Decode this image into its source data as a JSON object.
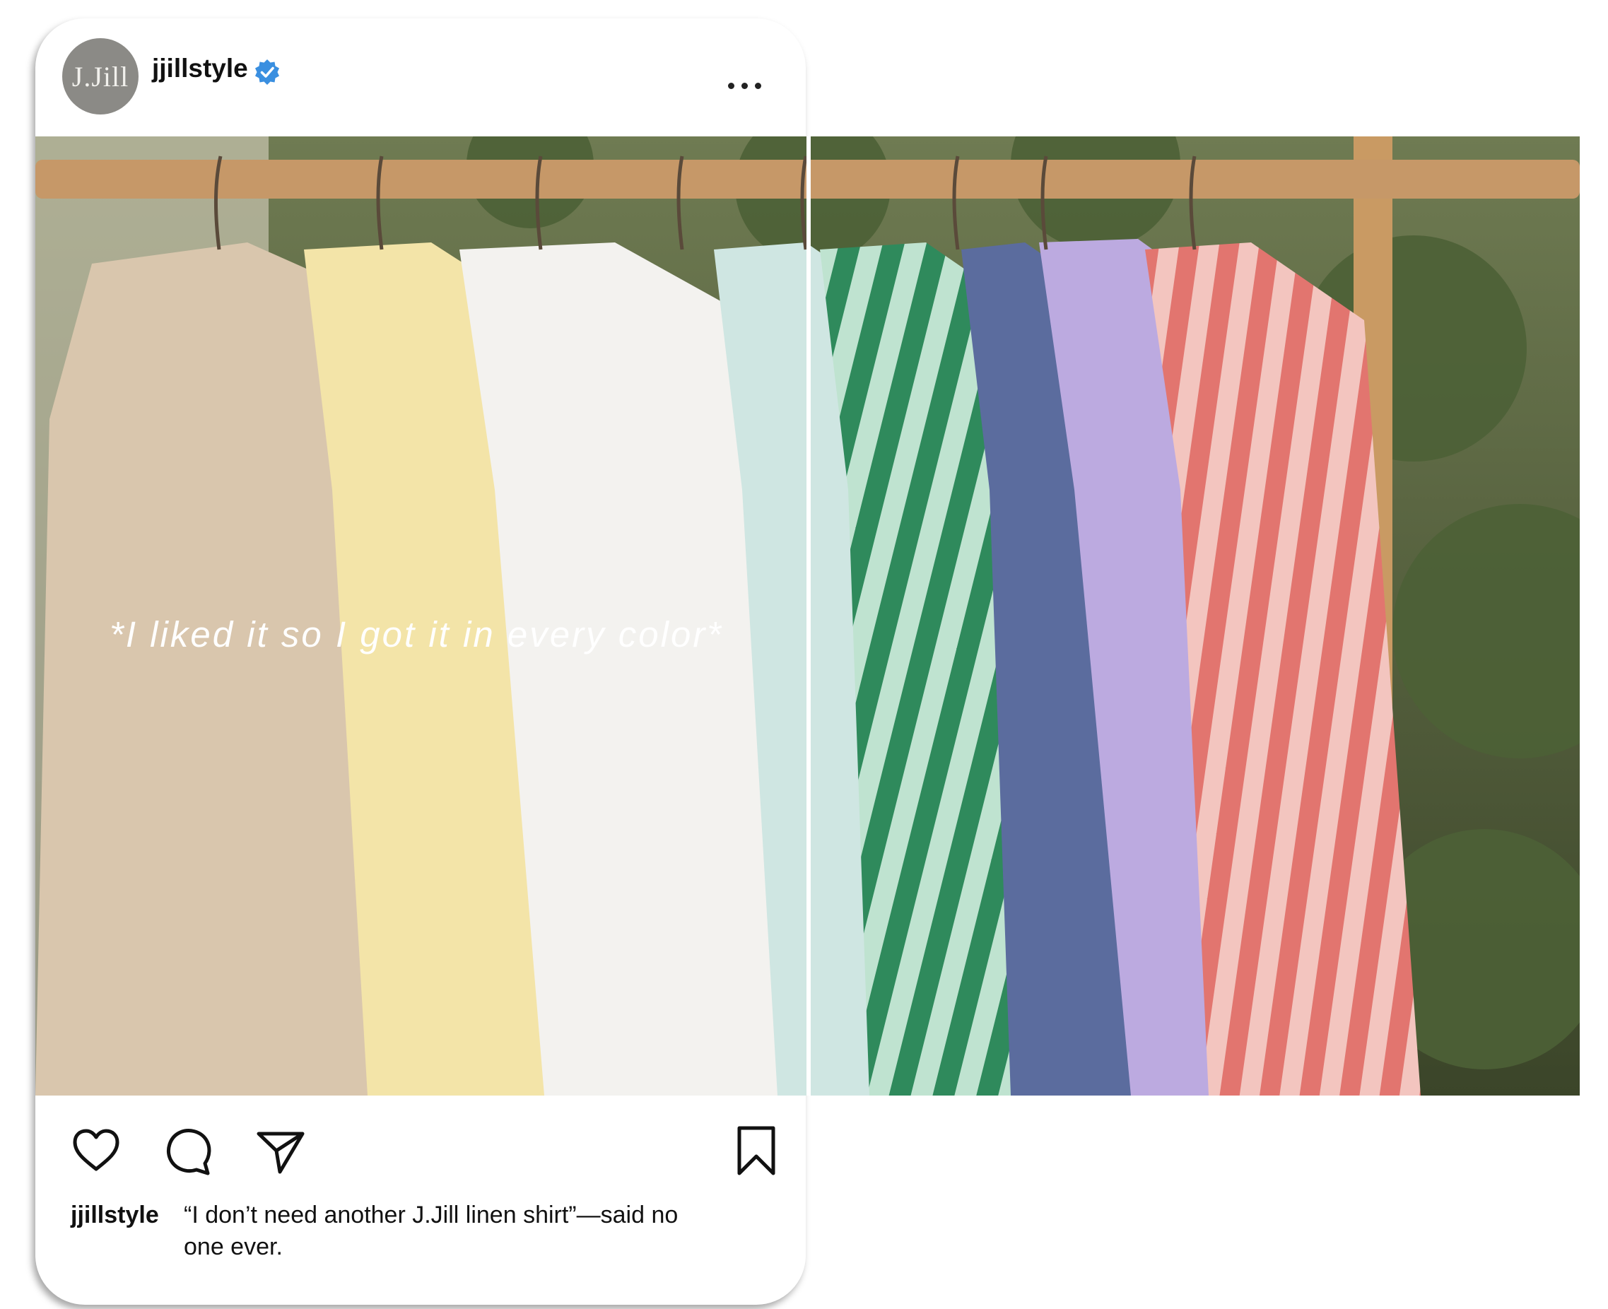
{
  "post": {
    "account": {
      "avatar_text": "J.Jill",
      "username": "jjillstyle",
      "verified": true
    },
    "menu_icon": "more-horizontal-icon",
    "image": {
      "overlay_text": "*I liked it so I got it in every color*",
      "description_colors": [
        "#d6c3aa",
        "#f3e4a7",
        "#f2f1ee",
        "#cfe5e2",
        "#2f8a5c",
        "#5a6b9c",
        "#b9a7df",
        "#e78a83"
      ]
    },
    "actions": {
      "like_icon": "heart-icon",
      "comment_icon": "comment-icon",
      "share_icon": "send-icon",
      "save_icon": "bookmark-icon"
    },
    "caption": {
      "username": "jjillstyle",
      "text": "“I don’t need another J.Jill linen shirt”—said no one ever."
    }
  }
}
